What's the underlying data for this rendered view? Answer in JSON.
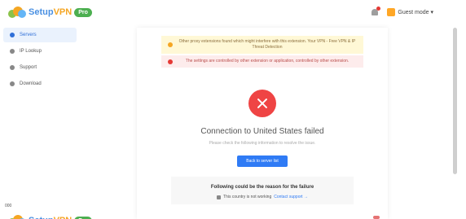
{
  "app": {
    "logo_text_main": "Setup",
    "logo_text_accent": "VPN",
    "logo_badge": "Pro"
  },
  "header": {
    "user_name": "Guest mode ▾"
  },
  "sidebar": {
    "items": [
      {
        "label": "Servers",
        "active": true
      },
      {
        "label": "IP Lookup",
        "active": false
      },
      {
        "label": "Support",
        "active": false
      },
      {
        "label": "Download",
        "active": false
      }
    ]
  },
  "alerts": {
    "warning": "Other proxy extensions found which might interfere with this extension. Your VPN - Free VPN & IP Threat Detection",
    "error": "The settings are controlled by other extension or application, controlled by other extension."
  },
  "status": {
    "title": "Connection to United States failed",
    "subtitle": "Please check the following information to resolve the issue.",
    "button_label": "Back to server list"
  },
  "reasons": {
    "title": "Following could be the reason for the failure",
    "item_text": "This country is not working",
    "item_link": "Contact support →"
  },
  "bottom": {
    "label": "000"
  },
  "colors": {
    "accent": "#2f7bf5",
    "danger": "#ef4444",
    "warning_bg": "#fff8d6",
    "error_bg": "#fdecec"
  }
}
